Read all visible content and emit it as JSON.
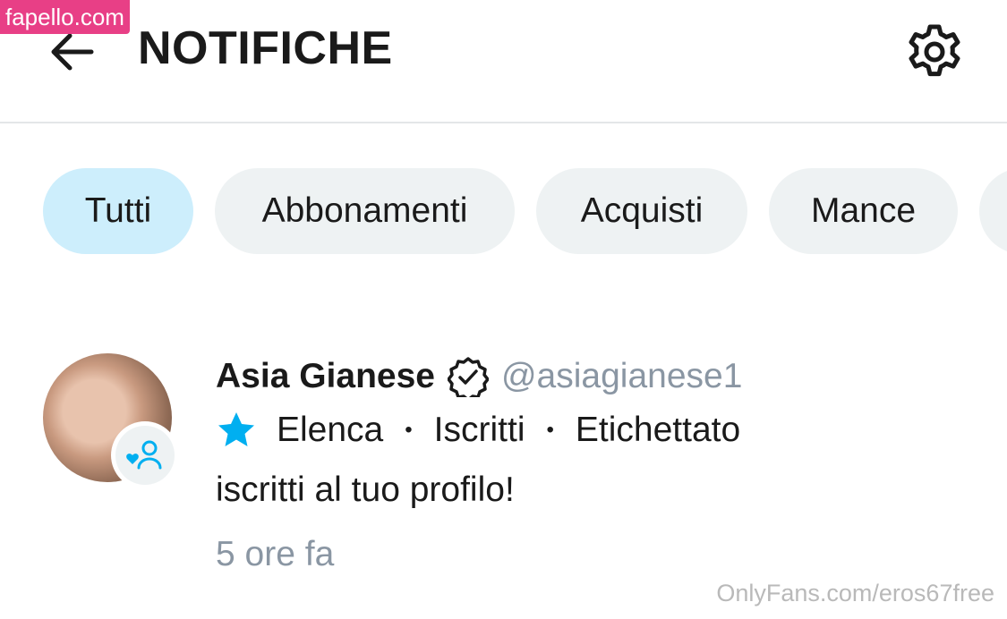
{
  "watermark_top": "fapello.com",
  "header": {
    "title": "NOTIFICHE",
    "back_icon": "arrow-left-icon",
    "settings_icon": "gear-icon"
  },
  "tabs": [
    {
      "label": "Tutti",
      "active": true
    },
    {
      "label": "Abbonamenti",
      "active": false
    },
    {
      "label": "Acquisti",
      "active": false
    },
    {
      "label": "Mance",
      "active": false
    }
  ],
  "notification": {
    "name": "Asia Gianese",
    "verified_icon": "verified-badge-icon",
    "handle": "@asiagianese1",
    "tags": [
      "Elenca",
      "Iscritti",
      "Etichettato"
    ],
    "tag_separator": "•",
    "star_icon": "star-icon",
    "message": "iscritti al tuo profilo!",
    "time": "5 ore fa",
    "avatar_badge_icon": "subscriber-heart-icon"
  },
  "watermark_bottom": "OnlyFans.com/eros67free",
  "colors": {
    "accent": "#00aff0",
    "active_chip": "#cdeefc",
    "chip": "#eef2f3",
    "muted_text": "#8a96a3",
    "watermark_pink": "#e83f86"
  }
}
